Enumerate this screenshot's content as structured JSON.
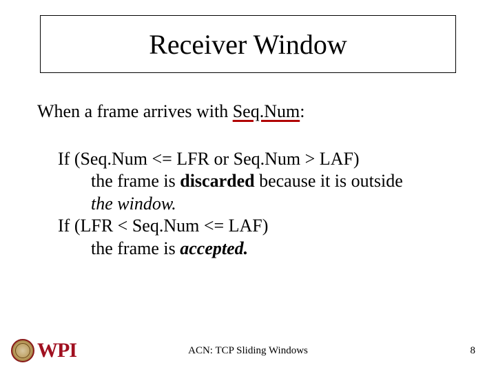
{
  "title": "Receiver Window",
  "intro_prefix": "When a frame arrives with ",
  "intro_seqnum": "Seq.Num",
  "intro_colon": ":",
  "cond1_if": "If  (Seq.Num <= LFR or Seq.Num > LAF)",
  "cond1_line2_pre": "the frame is ",
  "cond1_bold": "discarded",
  "cond1_line2_post": "  because it is outside",
  "cond1_line3": "the window.",
  "cond2_if": "If  (LFR < Seq.Num <=  LAF)",
  "cond2_line2_pre": "the frame is ",
  "cond2_bold": "accepted.",
  "footer_center": "ACN: TCP Sliding Windows",
  "footer_page": "8",
  "logo_text": "WPI"
}
